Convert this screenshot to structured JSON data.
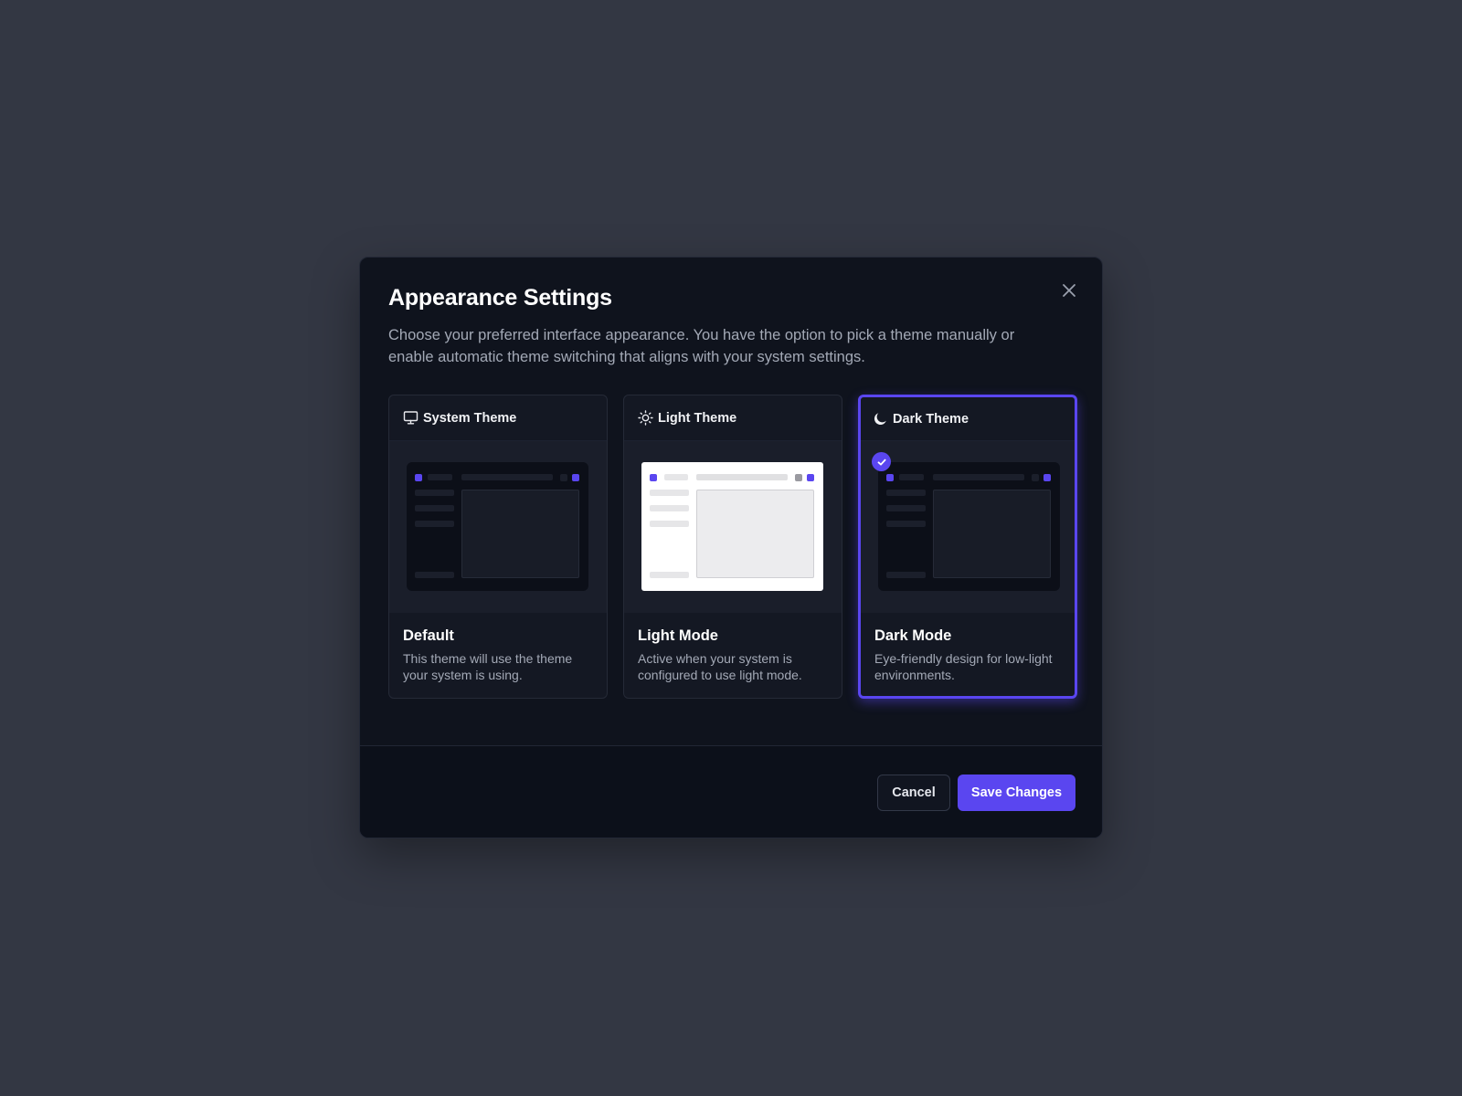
{
  "dialog": {
    "title": "Appearance Settings",
    "description": "Choose your preferred interface appearance. You have the option to pick a theme manually or enable automatic theme switching that aligns with your system settings."
  },
  "themes": [
    {
      "header": "System Theme",
      "icon": "monitor-icon",
      "name": "Default",
      "description": "This theme will use the theme your system is using.",
      "selected": false
    },
    {
      "header": "Light Theme",
      "icon": "sun-icon",
      "name": "Light Mode",
      "description": "Active when your system is configured to use light mode.",
      "selected": false
    },
    {
      "header": "Dark Theme",
      "icon": "moon-icon",
      "name": "Dark Mode",
      "description": "Eye-friendly design for low-light environments.",
      "selected": true
    }
  ],
  "footer": {
    "cancel_label": "Cancel",
    "save_label": "Save Changes"
  },
  "colors": {
    "accent": "#5a46f0",
    "background": "#333743",
    "modal": "#0f131d"
  }
}
